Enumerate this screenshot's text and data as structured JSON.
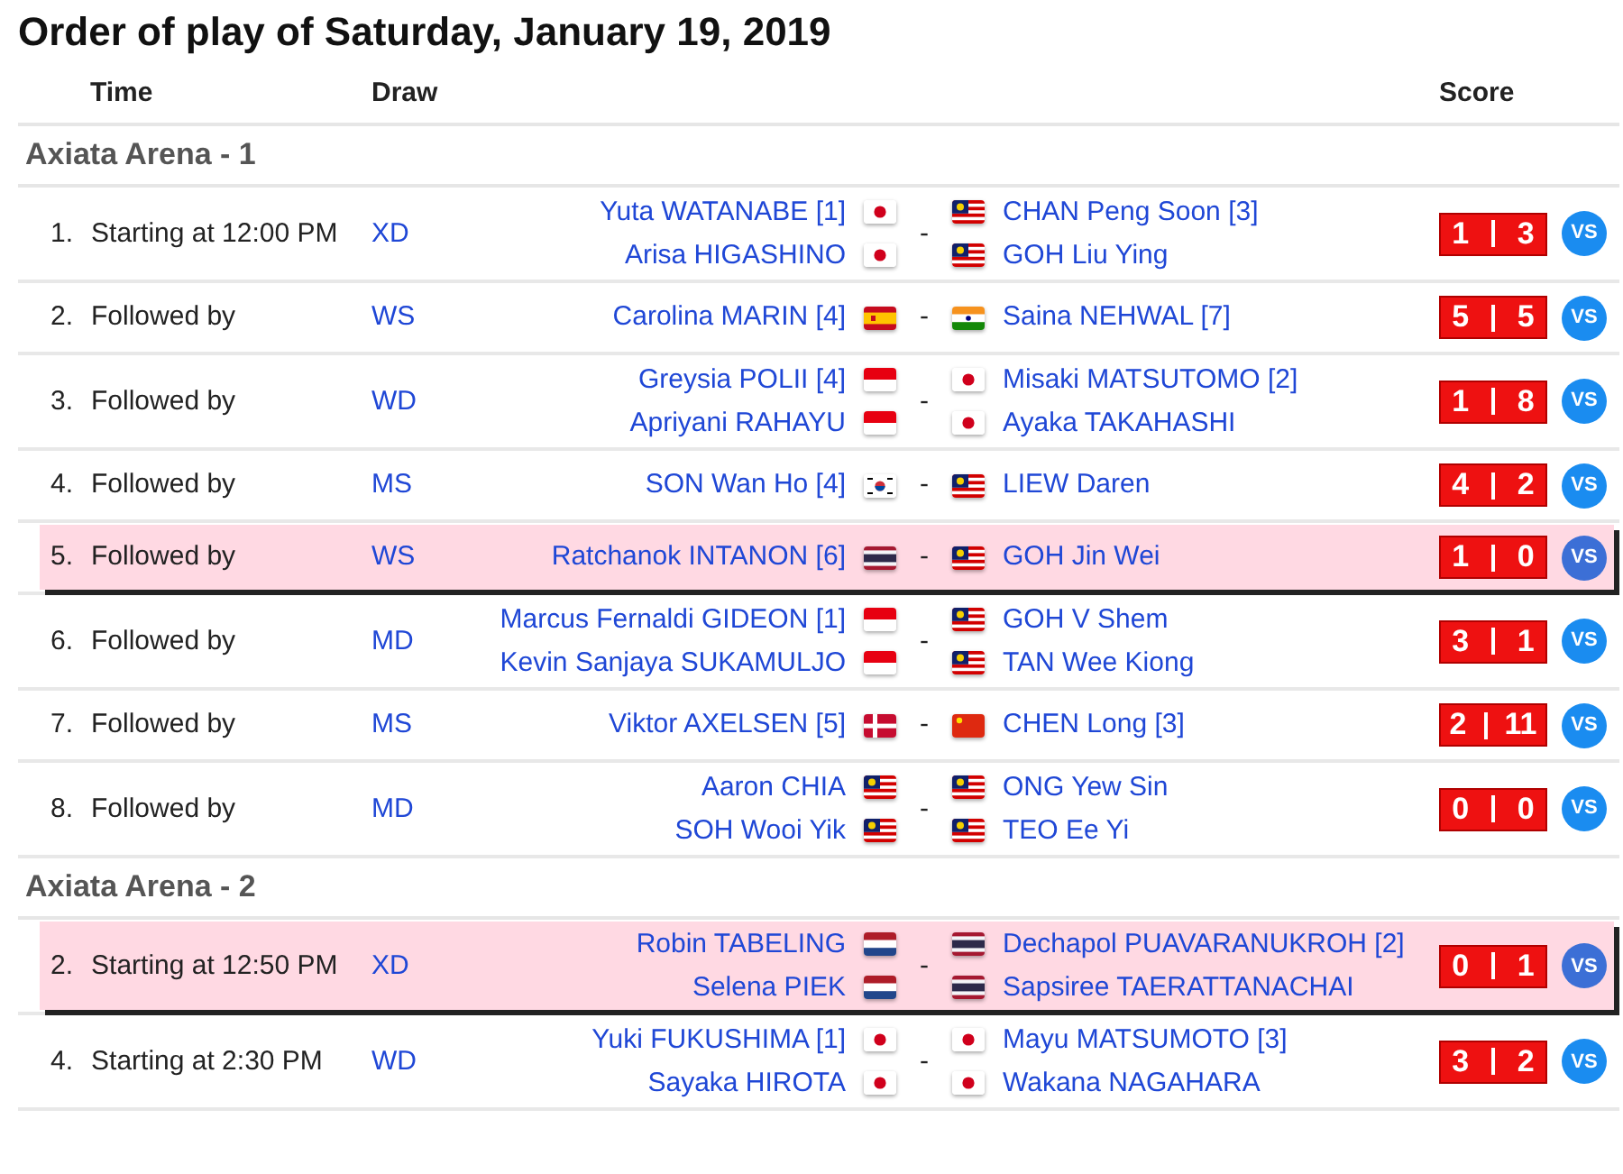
{
  "title": "Order of play of Saturday, January 19, 2019",
  "columns": [
    "Time",
    "Draw",
    "Score"
  ],
  "courts": [
    {
      "name": "Axiata Arena - 1",
      "matches": [
        {
          "number": "1.",
          "time": "Starting at 12:00 PM",
          "draw": "XD",
          "team1": [
            {
              "name": "Yuta WATANABE [1]",
              "kind": "jp"
            },
            {
              "name": "Arisa HIGASHINO",
              "kind": "jp"
            }
          ],
          "separator": "-",
          "team2": [
            {
              "name": "CHAN Peng Soon [3]",
              "kind": "my"
            },
            {
              "name": "GOH Liu Ying",
              "kind": "my"
            }
          ],
          "score": [
            "1",
            "3"
          ],
          "vs": "VS",
          "highlighted": false
        },
        {
          "number": "2.",
          "time": "Followed by",
          "draw": "WS",
          "team1": [
            {
              "name": "Carolina MARIN [4]",
              "kind": "es"
            }
          ],
          "separator": "-",
          "team2": [
            {
              "name": "Saina NEHWAL [7]",
              "kind": "in"
            }
          ],
          "score": [
            "5",
            "5"
          ],
          "vs": "VS",
          "highlighted": false
        },
        {
          "number": "3.",
          "time": "Followed by",
          "draw": "WD",
          "team1": [
            {
              "name": "Greysia POLII [4]",
              "kind": "id"
            },
            {
              "name": "Apriyani RAHAYU",
              "kind": "id"
            }
          ],
          "separator": "-",
          "team2": [
            {
              "name": "Misaki MATSUTOMO [2]",
              "kind": "jp"
            },
            {
              "name": "Ayaka TAKAHASHI",
              "kind": "jp"
            }
          ],
          "score": [
            "1",
            "8"
          ],
          "vs": "VS",
          "highlighted": false
        },
        {
          "number": "4.",
          "time": "Followed by",
          "draw": "MS",
          "team1": [
            {
              "name": "SON Wan Ho [4]",
              "kind": "kr"
            }
          ],
          "separator": "-",
          "team2": [
            {
              "name": "LIEW Daren",
              "kind": "my"
            }
          ],
          "score": [
            "4",
            "2"
          ],
          "vs": "VS",
          "highlighted": false
        },
        {
          "number": "5.",
          "time": "Followed by",
          "draw": "WS",
          "team1": [
            {
              "name": "Ratchanok INTANON [6]",
              "kind": "th"
            }
          ],
          "separator": "-",
          "team2": [
            {
              "name": "GOH Jin Wei",
              "kind": "my"
            }
          ],
          "score": [
            "1",
            "0"
          ],
          "vs": "VS",
          "highlighted": true
        },
        {
          "number": "6.",
          "time": "Followed by",
          "draw": "MD",
          "team1": [
            {
              "name": "Marcus Fernaldi GIDEON [1]",
              "kind": "id"
            },
            {
              "name": "Kevin Sanjaya SUKAMULJO",
              "kind": "id"
            }
          ],
          "separator": "-",
          "team2": [
            {
              "name": "GOH V Shem",
              "kind": "my"
            },
            {
              "name": "TAN Wee Kiong",
              "kind": "my"
            }
          ],
          "score": [
            "3",
            "1"
          ],
          "vs": "VS",
          "highlighted": false
        },
        {
          "number": "7.",
          "time": "Followed by",
          "draw": "MS",
          "team1": [
            {
              "name": "Viktor AXELSEN [5]",
              "kind": "dk"
            }
          ],
          "separator": "-",
          "team2": [
            {
              "name": "CHEN Long [3]",
              "kind": "cn"
            }
          ],
          "score": [
            "2",
            "11"
          ],
          "vs": "VS",
          "highlighted": false
        },
        {
          "number": "8.",
          "time": "Followed by",
          "draw": "MD",
          "team1": [
            {
              "name": "Aaron CHIA",
              "kind": "my"
            },
            {
              "name": "SOH Wooi Yik",
              "kind": "my"
            }
          ],
          "separator": "-",
          "team2": [
            {
              "name": "ONG Yew Sin",
              "kind": "my"
            },
            {
              "name": "TEO Ee Yi",
              "kind": "my"
            }
          ],
          "score": [
            "0",
            "0"
          ],
          "vs": "VS",
          "highlighted": false
        }
      ]
    },
    {
      "name": "Axiata Arena - 2",
      "matches": [
        {
          "number": "2.",
          "time": "Starting at 12:50 PM",
          "draw": "XD",
          "team1": [
            {
              "name": "Robin TABELING",
              "kind": "nl"
            },
            {
              "name": "Selena PIEK",
              "kind": "nl"
            }
          ],
          "separator": "-",
          "team2": [
            {
              "name": "Dechapol PUAVARANUKROH [2]",
              "kind": "th"
            },
            {
              "name": "Sapsiree TAERATTANACHAI",
              "kind": "th"
            }
          ],
          "score": [
            "0",
            "1"
          ],
          "vs": "VS",
          "highlighted": true
        },
        {
          "number": "4.",
          "time": "Starting at 2:30 PM",
          "draw": "WD",
          "team1": [
            {
              "name": "Yuki FUKUSHIMA [1]",
              "kind": "jp"
            },
            {
              "name": "Sayaka HIROTA",
              "kind": "jp"
            }
          ],
          "separator": "-",
          "team2": [
            {
              "name": "Mayu MATSUMOTO [3]",
              "kind": "jp"
            },
            {
              "name": "Wakana NAGAHARA",
              "kind": "jp"
            }
          ],
          "score": [
            "3",
            "2"
          ],
          "vs": "VS",
          "highlighted": false
        }
      ]
    }
  ]
}
